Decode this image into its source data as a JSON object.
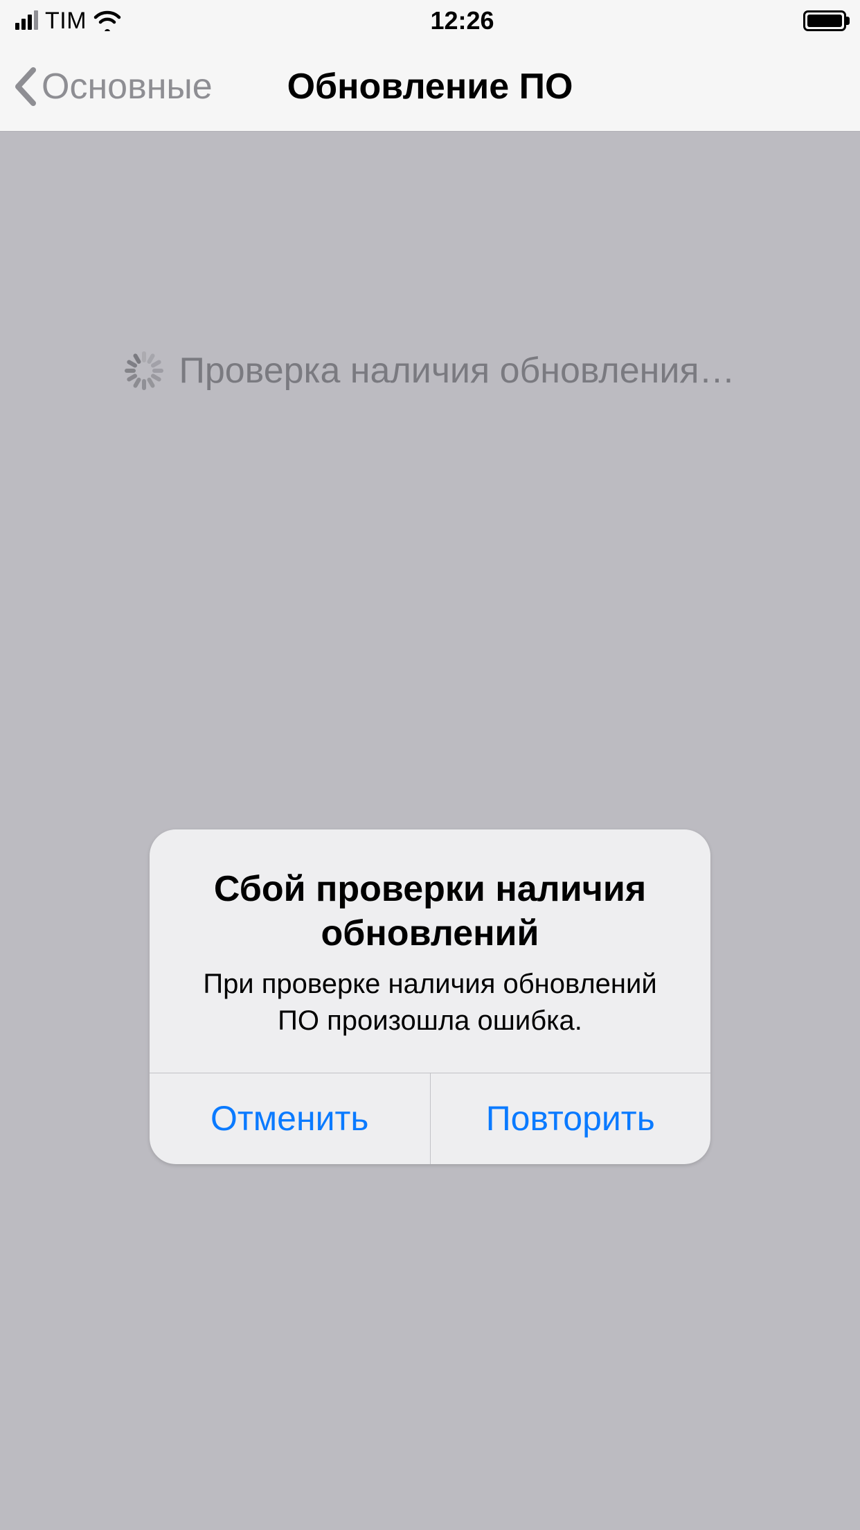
{
  "status": {
    "carrier": "TIM",
    "time": "12:26"
  },
  "nav": {
    "back_label": "Основные",
    "title": "Обновление ПО"
  },
  "content": {
    "loading_text": "Проверка наличия обновления…"
  },
  "alert": {
    "title": "Сбой проверки наличия обновлений",
    "message": "При проверке наличия обновлений ПО произошла ошибка.",
    "cancel_label": "Отменить",
    "retry_label": "Повторить"
  },
  "colors": {
    "tint": "#0a7aff",
    "bg": "#bcbbc1",
    "bar": "#f6f6f6",
    "secondary": "#8e8e93"
  }
}
